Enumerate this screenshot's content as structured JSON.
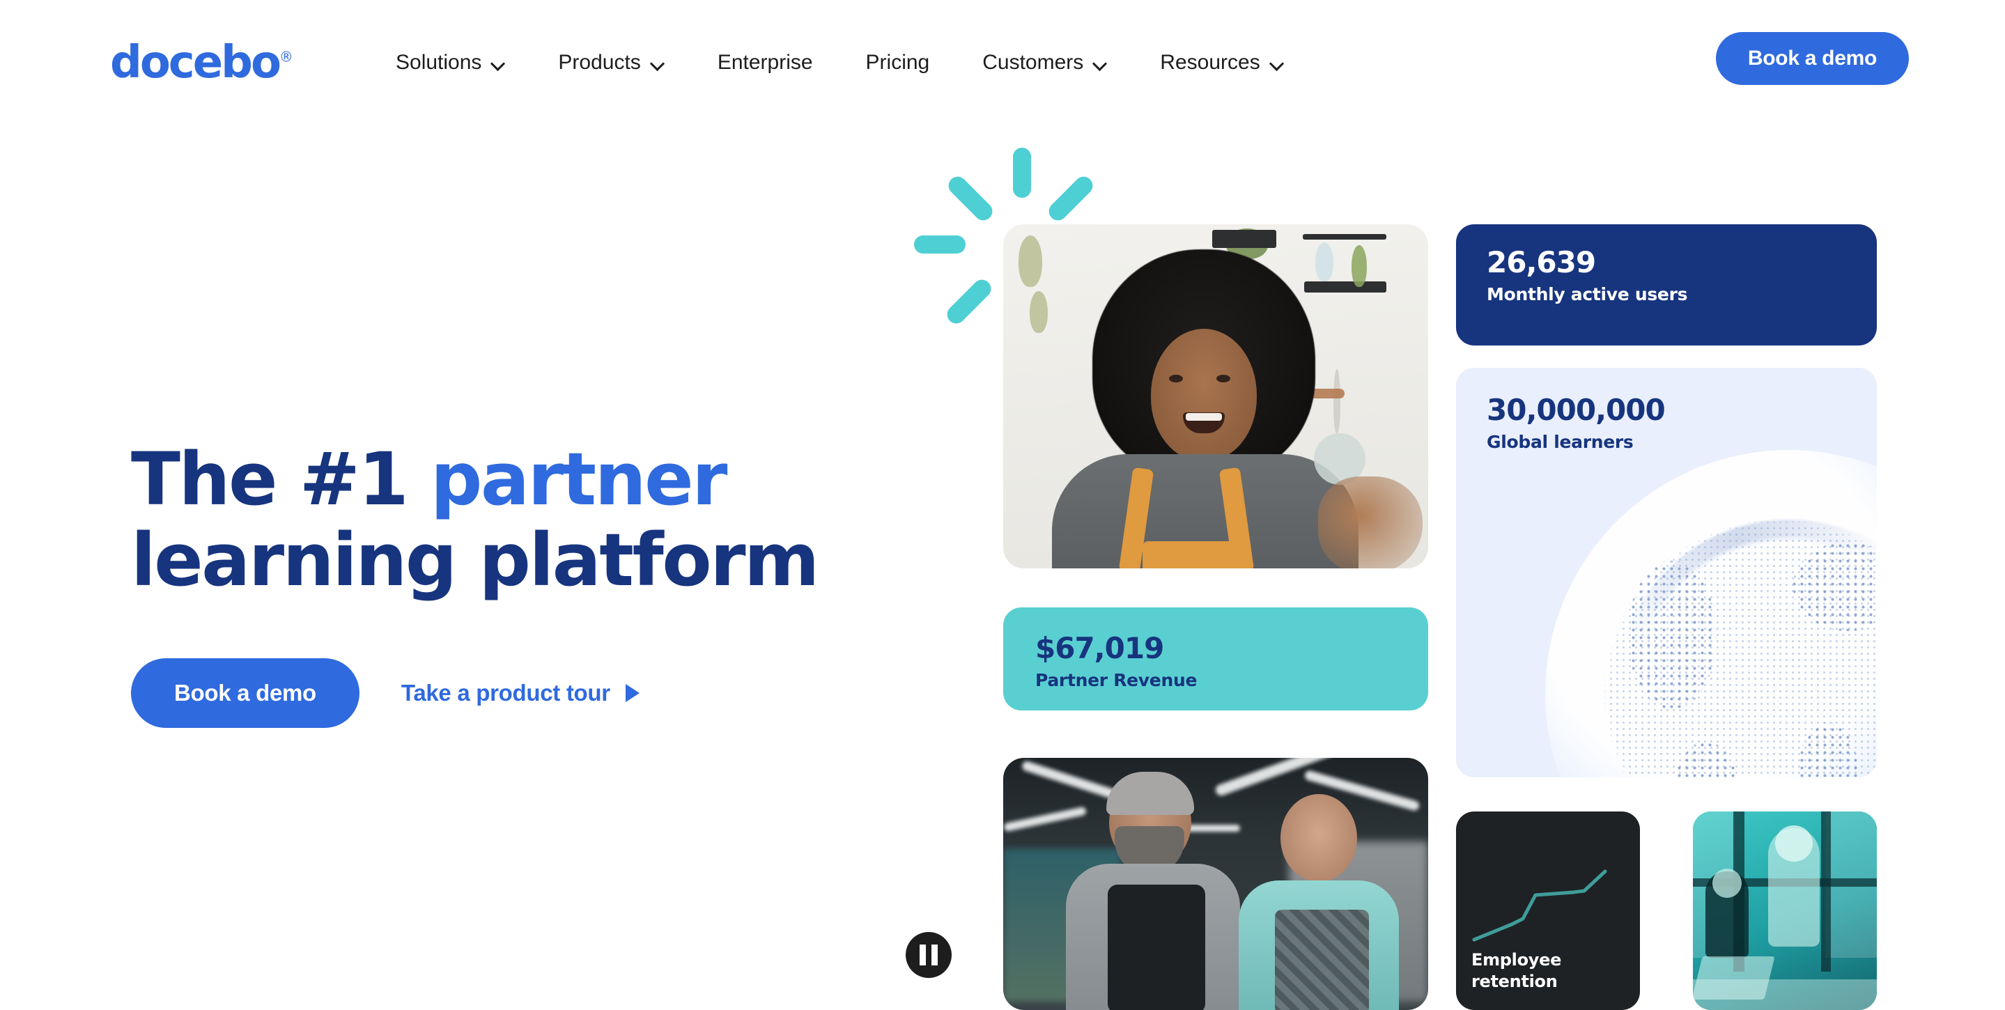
{
  "brand": {
    "logo_text": "docebo",
    "logo_registered": "®",
    "logo_color": "#2f6ade"
  },
  "nav": {
    "items": [
      {
        "label": "Solutions",
        "has_dropdown": true,
        "icon": "chevron-down-icon"
      },
      {
        "label": "Products",
        "has_dropdown": true,
        "icon": "chevron-down-icon"
      },
      {
        "label": "Enterprise",
        "has_dropdown": false,
        "icon": ""
      },
      {
        "label": "Pricing",
        "has_dropdown": false,
        "icon": ""
      },
      {
        "label": "Customers",
        "has_dropdown": true,
        "icon": "chevron-down-icon"
      },
      {
        "label": "Resources",
        "has_dropdown": true,
        "icon": "chevron-down-icon"
      }
    ],
    "cta_label": "Book a demo"
  },
  "hero": {
    "headline_line1_a": "The #1 ",
    "headline_line1_b": "partner",
    "headline_line2": "learning platform",
    "headline_color": "#17347e",
    "headline_accent_color": "#2f6ade",
    "primary_cta": "Book a demo",
    "secondary_cta": "Take a product tour",
    "secondary_cta_icon": "play-triangle-icon"
  },
  "stats": {
    "monthly_active_users": {
      "value": "26,639",
      "label": "Monthly active users",
      "bg": "#17347e",
      "fg": "#ffffff"
    },
    "global_learners": {
      "value": "30,000,000",
      "label": "Global learners",
      "bg": "#e9effc",
      "fg": "#17347e"
    },
    "partner_revenue": {
      "value": "$67,019",
      "label": "Partner Revenue",
      "bg": "#5acfd1",
      "fg": "#17347e"
    },
    "employee_retention": {
      "label_line1": "Employee",
      "label_line2": "retention",
      "bg": "#1f2224",
      "fg": "#ffffff",
      "line_color": "#3f9d9b"
    }
  },
  "media": {
    "photo_top_alt": "Smiling woman with afro in a craft shop",
    "photo_bottom_alt": "Two smiling store employees in aprons",
    "photo_teal_alt": "Colleagues collaborating at a desk, teal duotone",
    "decoration": "teal-burst-icon"
  },
  "controls": {
    "pause_label": "Pause",
    "pause_icon": "pause-icon"
  }
}
